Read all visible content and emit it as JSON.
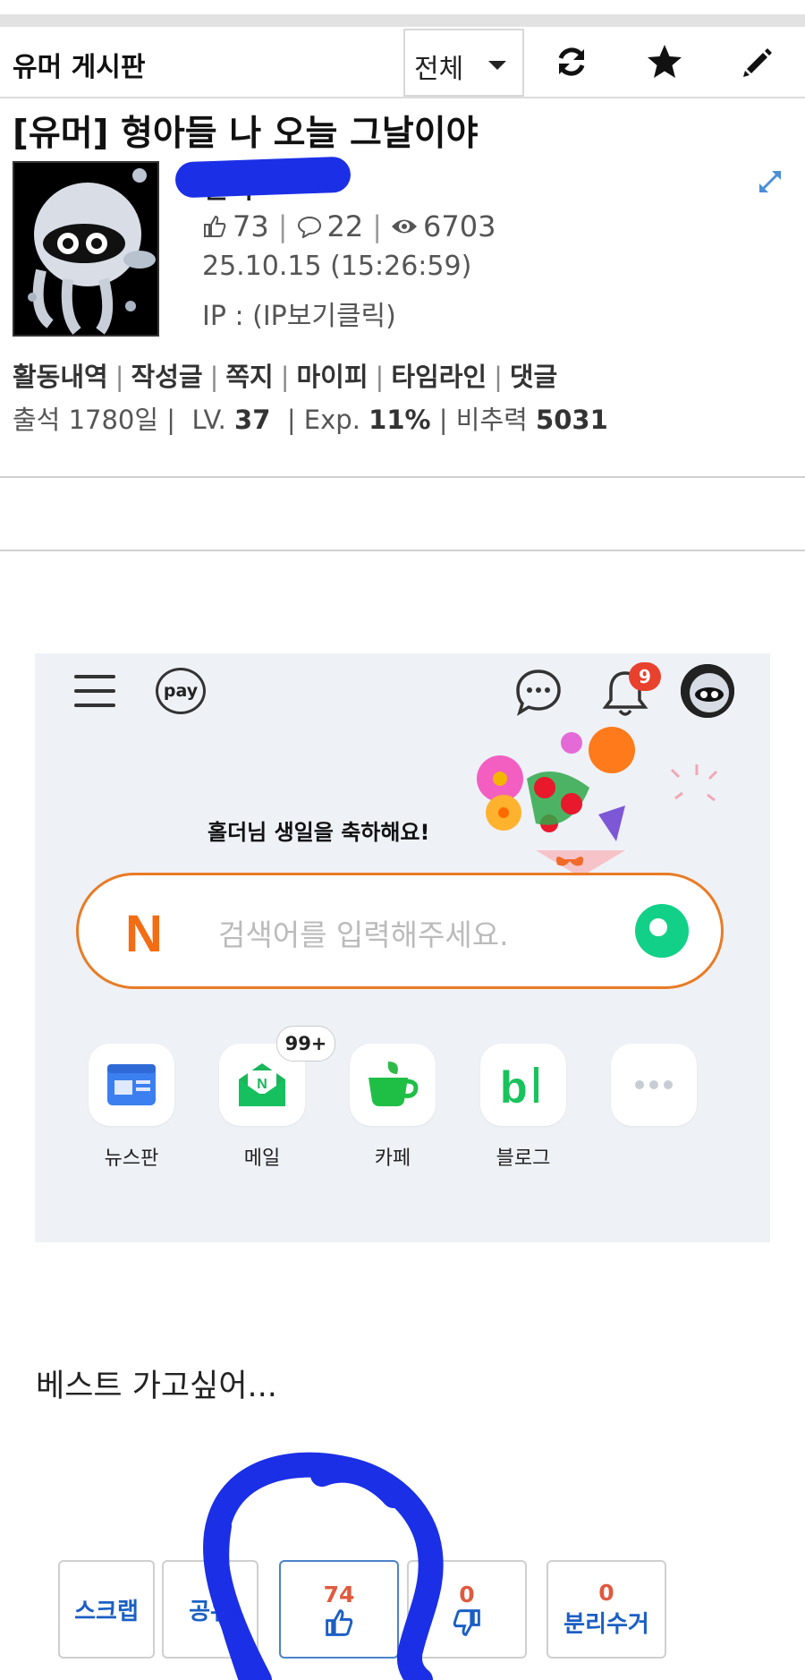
{
  "header": {
    "board_title": "유머 게시판",
    "filter_value": "전체",
    "refresh_icon": "refresh-icon",
    "favorite_icon": "star-icon",
    "write_icon": "pencil-icon"
  },
  "post": {
    "title": "[유머] 형아들 나 오늘 그날이야",
    "author": "홀더",
    "likes": "73",
    "comments": "22",
    "views": "6703",
    "date": "25.10.15 (15:26:59)",
    "ip": "IP : (IP보기클릭)",
    "links": [
      "활동내역",
      "작성글",
      "쪽지",
      "마이피",
      "타임라인",
      "댓글"
    ],
    "meta": {
      "attendance": "출석 1780일 |",
      "lv_label": "LV.",
      "lv_value": "37",
      "exp_label": "| Exp.",
      "exp_value": "11%",
      "nonrec_label": "| 비추력",
      "nonrec_value": "5031"
    }
  },
  "embedded": {
    "pay_label": "pay",
    "notification_count": "9",
    "birthday_text": "홀더님 생일을 축하해요!",
    "search_logo": "N",
    "search_placeholder": "검색어를 입력해주세요.",
    "mail_badge": "99+",
    "shortcuts": [
      "뉴스판",
      "메일",
      "카페",
      "블로그"
    ]
  },
  "body_text": "베스트 가고싶어...",
  "actions": {
    "scrap": "스크랩",
    "share_partial": "공유",
    "upvotes": "74",
    "downvotes": "0",
    "separate": {
      "count": "0",
      "label": "분리수거"
    }
  },
  "colors": {
    "link_blue": "#1b5fc4",
    "count_red": "#e05a3f",
    "naver_orange": "#e97b24",
    "naver_green": "#12d087",
    "scribble_blue": "#1b2fe6"
  }
}
